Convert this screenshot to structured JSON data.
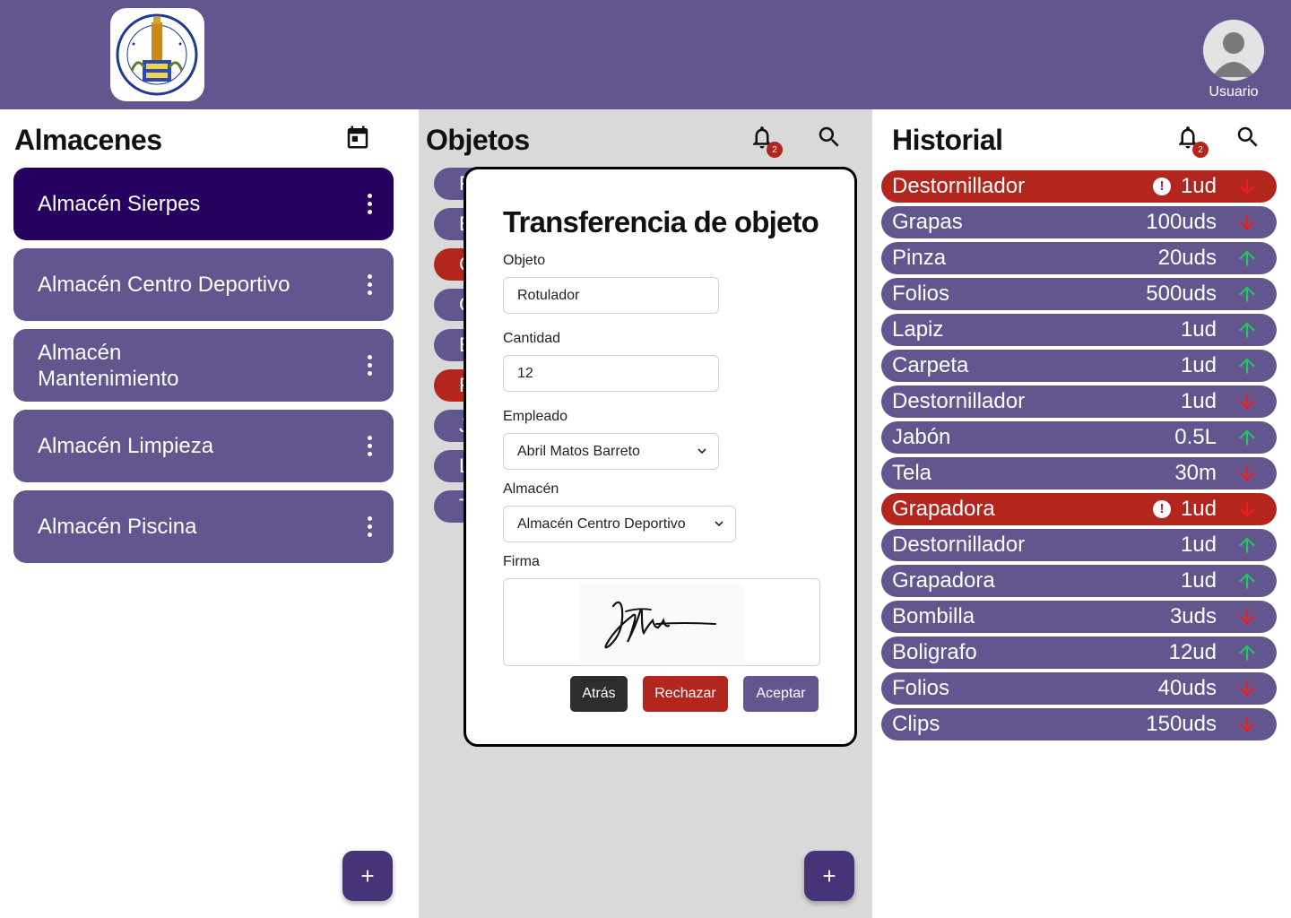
{
  "header": {
    "user_label": "Usuario"
  },
  "almacenes": {
    "title": "Almacenes",
    "items": [
      {
        "label": "Almacén Sierpes",
        "active": true
      },
      {
        "label": "Almacén Centro Deportivo",
        "active": false
      },
      {
        "label": "Almacén Mantenimiento",
        "active": false
      },
      {
        "label": "Almacén Limpieza",
        "active": false
      },
      {
        "label": "Almacén Piscina",
        "active": false
      }
    ],
    "add_label": "+"
  },
  "objetos": {
    "title": "Objetos",
    "notification_count": "2",
    "stubs": [
      {
        "label": "F",
        "color": "#63568f"
      },
      {
        "label": "E",
        "color": "#63568f"
      },
      {
        "label": "C",
        "color": "#b3261e"
      },
      {
        "label": "C",
        "color": "#63568f"
      },
      {
        "label": "E",
        "color": "#63568f"
      },
      {
        "label": "F",
        "color": "#b3261e"
      },
      {
        "label": "J",
        "color": "#63568f"
      },
      {
        "label": "L",
        "color": "#63568f"
      },
      {
        "label": "T",
        "color": "#63568f"
      }
    ],
    "add_label": "+"
  },
  "modal": {
    "title": "Transferencia de objeto",
    "objeto_label": "Objeto",
    "objeto_value": "Rotulador",
    "cantidad_label": "Cantidad",
    "cantidad_value": "12",
    "empleado_label": "Empleado",
    "empleado_value": "Abril Matos Barreto",
    "almacen_label": "Almacén",
    "almacen_value": "Almacén Centro Deportivo",
    "firma_label": "Firma",
    "back_label": "Atrás",
    "reject_label": "Rechazar",
    "accept_label": "Aceptar"
  },
  "historial": {
    "title": "Historial",
    "notification_count": "2",
    "items": [
      {
        "name": "Destornillador",
        "qty": "1ud",
        "direction": "down",
        "alert": true
      },
      {
        "name": "Grapas",
        "qty": "100uds",
        "direction": "down",
        "alert": false
      },
      {
        "name": "Pinza",
        "qty": "20uds",
        "direction": "up",
        "alert": false
      },
      {
        "name": "Folios",
        "qty": "500uds",
        "direction": "up",
        "alert": false
      },
      {
        "name": "Lapiz",
        "qty": "1ud",
        "direction": "up",
        "alert": false
      },
      {
        "name": "Carpeta",
        "qty": "1ud",
        "direction": "up",
        "alert": false
      },
      {
        "name": "Destornillador",
        "qty": "1ud",
        "direction": "down",
        "alert": false
      },
      {
        "name": "Jabón",
        "qty": "0.5L",
        "direction": "up",
        "alert": false
      },
      {
        "name": "Tela",
        "qty": "30m",
        "direction": "down",
        "alert": false
      },
      {
        "name": "Grapadora",
        "qty": "1ud",
        "direction": "down",
        "alert": true
      },
      {
        "name": "Destornillador",
        "qty": "1ud",
        "direction": "up",
        "alert": false
      },
      {
        "name": "Grapadora",
        "qty": "1ud",
        "direction": "up",
        "alert": false
      },
      {
        "name": "Bombilla",
        "qty": "3uds",
        "direction": "down",
        "alert": false
      },
      {
        "name": "Boligrafo",
        "qty": "12ud",
        "direction": "up",
        "alert": false
      },
      {
        "name": "Folios",
        "qty": "40uds",
        "direction": "down",
        "alert": false
      },
      {
        "name": "Clips",
        "qty": "150uds",
        "direction": "down",
        "alert": false
      }
    ]
  },
  "colors": {
    "primary": "#63568f",
    "primary_dark": "#25005e",
    "danger": "#b3261e",
    "arrow_up": "#22c55e",
    "arrow_down": "#ef1c1c"
  }
}
